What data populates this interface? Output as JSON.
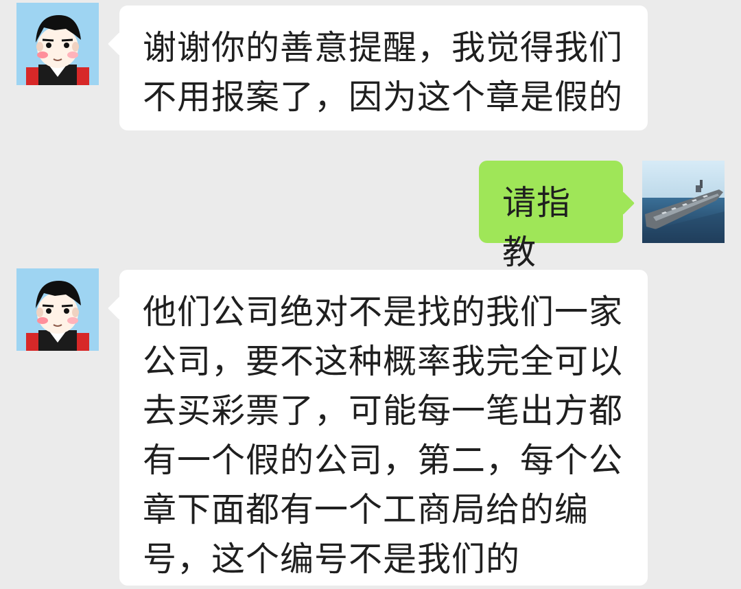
{
  "chat": {
    "messages": [
      {
        "side": "left",
        "text": "谢谢你的善意提醒，我觉得我们不用报案了，因为这个章是假的",
        "avatar_icon": "cartoon-boy-avatar-icon"
      },
      {
        "side": "right",
        "text": "请指教",
        "avatar_icon": "aircraft-carrier-avatar-icon"
      },
      {
        "side": "left",
        "text": "他们公司绝对不是找的我们一家公司，要不这种概率我完全可以去买彩票了，可能每一笔出方都有一个假的公司，第二，每个公章下面都有一个工商局给的编号，这个编号不是我们的",
        "avatar_icon": "cartoon-boy-avatar-icon"
      }
    ]
  },
  "colors": {
    "background": "#ebebeb",
    "left_bubble": "#ffffff",
    "right_bubble": "#9fe658",
    "text": "#1f1f1f",
    "avatar_bg": "#9ed4f2"
  }
}
